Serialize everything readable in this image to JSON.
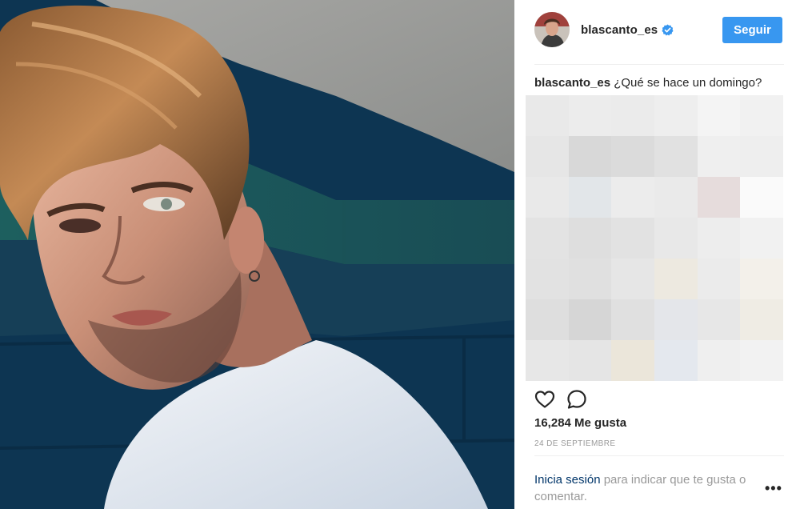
{
  "post": {
    "author": {
      "username": "blascanto_es",
      "verified": true,
      "avatar_icon": "avatar-photo"
    },
    "follow_label": "Seguir",
    "caption": {
      "username": "blascanto_es",
      "text": "¿Qué se hace un domingo?"
    },
    "likes_text": "16,284 Me gusta",
    "date_text": "24 DE SEPTIEMBRE",
    "login_prompt": {
      "link_text": "Inicia sesión",
      "rest_text": " para indicar que te gusta o comentar."
    },
    "more_label": "•••"
  },
  "icons": {
    "like": "heart-outline-icon",
    "comment": "comment-bubble-icon",
    "verified": "verified-badge-icon",
    "more": "more-options-icon"
  },
  "colors": {
    "follow_button": "#3897f0",
    "link": "#003569",
    "muted_text": "#999999",
    "primary_text": "#262626",
    "verified_badge": "#3897f0"
  },
  "pixelated_comments": {
    "cell_colors": [
      "#e9e9e9",
      "#ececec",
      "#ebebeb",
      "#eeeeee",
      "#f4f4f4",
      "#f1f1f1",
      "#e6e6e6",
      "#d8d8d8",
      "#dbdbdb",
      "#e1e1e1",
      "#efefef",
      "#eeeeee",
      "#e9e9e9",
      "#e2e6e9",
      "#ececec",
      "#eaeaea",
      "#e6dcdc",
      "#fafafa",
      "#e3e3e3",
      "#dedede",
      "#e2e2e2",
      "#e8e8e8",
      "#ededed",
      "#f1f1f1",
      "#e2e2e2",
      "#e0e0e0",
      "#e6e6e6",
      "#ede9e0",
      "#ebebeb",
      "#f3f0ea",
      "#dedede",
      "#d6d6d6",
      "#e0e0e0",
      "#e4e6ea",
      "#e7e7e7",
      "#efece4",
      "#e7e7e7",
      "#e5e5e5",
      "#ebe6da",
      "#e4e8ee",
      "#efefef",
      "#f2f2f2"
    ]
  }
}
